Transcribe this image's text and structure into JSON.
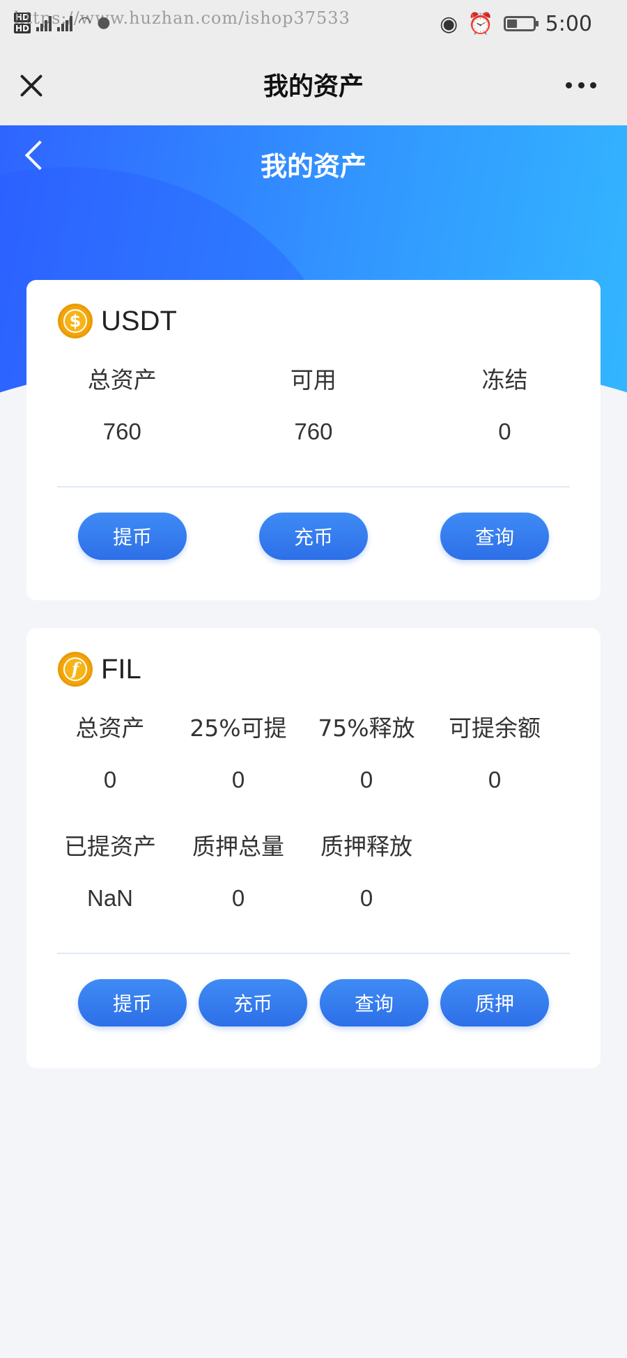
{
  "status_bar": {
    "watermark": "https://www.huzhan.com/ishop37533",
    "network": "4G",
    "time": "5:00"
  },
  "title_bar": {
    "title": "我的资产"
  },
  "header": {
    "title": "我的资产"
  },
  "usdt": {
    "name": "USDT",
    "icon_symbol": "$",
    "labels": [
      "总资产",
      "可用",
      "冻结"
    ],
    "values": [
      "760",
      "760",
      "0"
    ],
    "buttons": [
      "提币",
      "充币",
      "查询"
    ]
  },
  "fil": {
    "name": "FIL",
    "icon_symbol": "f",
    "row1_labels": [
      "总资产",
      "25%可提",
      "75%释放",
      "可提余额"
    ],
    "row1_values": [
      "0",
      "0",
      "0",
      "0"
    ],
    "row2_labels": [
      "已提资产",
      "质押总量",
      "质押释放"
    ],
    "row2_values": [
      "NaN",
      "0",
      "0"
    ],
    "buttons": [
      "提币",
      "充币",
      "查询",
      "质押"
    ]
  },
  "colors": {
    "header_start": "#2f64ff",
    "header_end": "#33b6ff",
    "button": "#2d6fe8",
    "coin": "#f7b418",
    "background": "#f3f5f9"
  }
}
